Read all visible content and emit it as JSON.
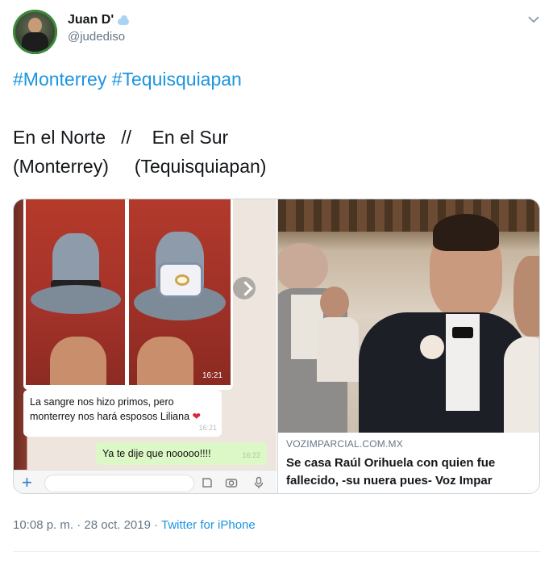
{
  "author": {
    "display_name": "Juan D'",
    "handle": "@judediso",
    "name_emoji_icon": "cloud-icon"
  },
  "menu_icon": "chevron-down-icon",
  "tweet": {
    "hashtags": "#Monterrey #Tequisquiapan",
    "line1": "En el Norte   //    En el Sur",
    "line2": "(Monterrey)     (Tequisquiapan)"
  },
  "media_left": {
    "photo_time": "16:21",
    "message_in_line1": "La sangre nos hizo primos, pero",
    "message_in_line2": "monterrey nos hará esposos Liliana",
    "message_in_emoji": "❤",
    "message_in_time": "16:21",
    "message_out": "Ya te dije que nooooo!!!!",
    "message_out_time": "16:22",
    "plus_label": "+"
  },
  "media_right": {
    "source": "VOZIMPARCIAL.COM.MX",
    "title_line1": "Se casa Raúl Orihuela con quien fue",
    "title_line2": "fallecido, -su nuera pues- Voz Impar"
  },
  "footer": {
    "timestamp": "10:08 p. m. · 28 oct. 2019 · ",
    "via": "Twitter for iPhone"
  },
  "colors": {
    "link": "#1b95e0",
    "secondary_text": "#657786",
    "whatsapp_out_bubble": "#dcf8c6"
  }
}
